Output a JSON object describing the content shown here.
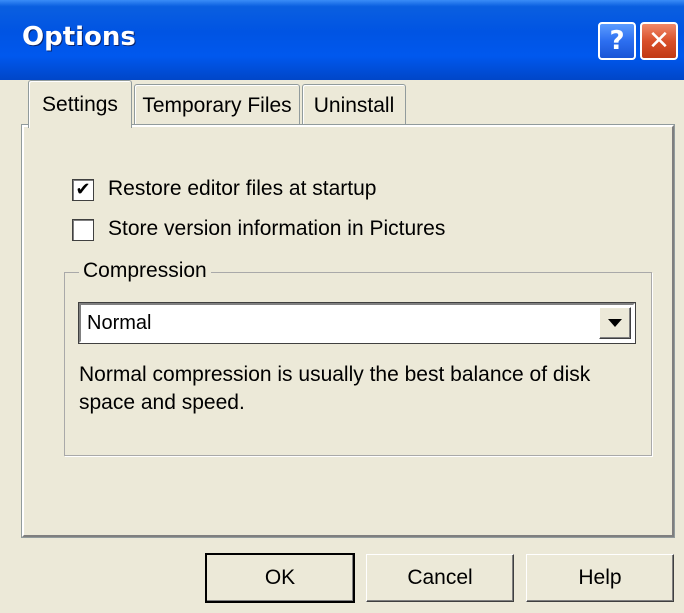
{
  "window": {
    "title": "Options",
    "help_glyph": "?",
    "close_glyph": "✕"
  },
  "tabs": [
    {
      "label": "Settings",
      "active": true
    },
    {
      "label": "Temporary Files",
      "active": false
    },
    {
      "label": "Uninstall",
      "active": false
    }
  ],
  "settings": {
    "restore_label": "Restore editor files at startup",
    "restore_checked": true,
    "store_version_label": "Store version information in Pictures",
    "store_version_checked": false,
    "compression": {
      "title": "Compression",
      "selected": "Normal",
      "description": "Normal compression is usually the best balance of disk space and speed."
    }
  },
  "buttons": {
    "ok": "OK",
    "cancel": "Cancel",
    "help": "Help"
  },
  "colors": {
    "titlebar": "#0054e3",
    "face": "#ece9d8",
    "close": "#d9502a"
  },
  "icons": {
    "help": "question-mark-icon",
    "close": "close-icon",
    "check": "checkmark-icon",
    "dropdown": "chevron-down-icon"
  }
}
